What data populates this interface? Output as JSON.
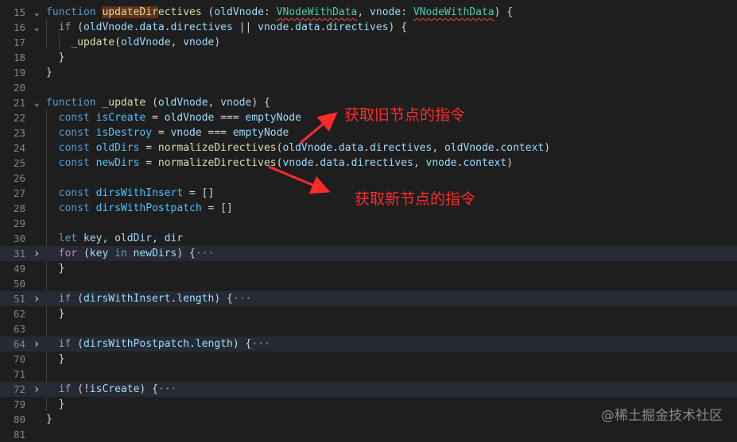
{
  "lines": [
    {
      "num": "15",
      "fold": "open",
      "tokens": [
        [
          "kw",
          "function"
        ],
        [
          "op",
          " "
        ],
        [
          "fn sel",
          "updateDir"
        ],
        [
          "fn",
          "ectives"
        ],
        [
          "op",
          " ("
        ],
        [
          "var",
          "oldVnode"
        ],
        [
          "op",
          ": "
        ],
        [
          "typ squig",
          "VNodeWithData"
        ],
        [
          "op",
          ", "
        ],
        [
          "var",
          "vnode"
        ],
        [
          "op",
          ": "
        ],
        [
          "typ squig",
          "VNodeWithData"
        ],
        [
          "op",
          ") {"
        ]
      ]
    },
    {
      "num": "16",
      "fold": "open",
      "tokens": [
        [
          "op",
          "  "
        ],
        [
          "ctl",
          "if"
        ],
        [
          "op",
          " ("
        ],
        [
          "var",
          "oldVnode"
        ],
        [
          "op",
          "."
        ],
        [
          "var",
          "data"
        ],
        [
          "op",
          "."
        ],
        [
          "var",
          "directives"
        ],
        [
          "op",
          " || "
        ],
        [
          "var",
          "vnode"
        ],
        [
          "op",
          "."
        ],
        [
          "var",
          "data"
        ],
        [
          "op",
          "."
        ],
        [
          "var",
          "directives"
        ],
        [
          "op",
          ") {"
        ]
      ]
    },
    {
      "num": "17",
      "fold": "",
      "tokens": [
        [
          "op",
          "    "
        ],
        [
          "fn",
          "_update"
        ],
        [
          "op",
          "("
        ],
        [
          "var",
          "oldVnode"
        ],
        [
          "op",
          ", "
        ],
        [
          "var",
          "vnode"
        ],
        [
          "op",
          ")"
        ]
      ]
    },
    {
      "num": "18",
      "fold": "",
      "tokens": [
        [
          "op",
          "  }"
        ]
      ]
    },
    {
      "num": "19",
      "fold": "",
      "tokens": [
        [
          "op",
          "}"
        ]
      ]
    },
    {
      "num": "20",
      "fold": "",
      "tokens": []
    },
    {
      "num": "21",
      "fold": "open",
      "tokens": [
        [
          "kw",
          "function"
        ],
        [
          "op",
          " "
        ],
        [
          "fn",
          "_update"
        ],
        [
          "op",
          " ("
        ],
        [
          "var",
          "oldVnode"
        ],
        [
          "op",
          ", "
        ],
        [
          "var",
          "vnode"
        ],
        [
          "op",
          ") {"
        ]
      ]
    },
    {
      "num": "22",
      "fold": "",
      "tokens": [
        [
          "op",
          "  "
        ],
        [
          "kw",
          "const"
        ],
        [
          "op",
          " "
        ],
        [
          "cst",
          "isCreate"
        ],
        [
          "op",
          " = "
        ],
        [
          "var",
          "oldVnode"
        ],
        [
          "op",
          " === "
        ],
        [
          "var",
          "emptyNode"
        ]
      ]
    },
    {
      "num": "23",
      "fold": "",
      "tokens": [
        [
          "op",
          "  "
        ],
        [
          "kw",
          "const"
        ],
        [
          "op",
          " "
        ],
        [
          "cst",
          "isDestroy"
        ],
        [
          "op",
          " = "
        ],
        [
          "var",
          "vnode"
        ],
        [
          "op",
          " === "
        ],
        [
          "var",
          "emptyNode"
        ]
      ]
    },
    {
      "num": "24",
      "fold": "",
      "tokens": [
        [
          "op",
          "  "
        ],
        [
          "kw",
          "const"
        ],
        [
          "op",
          " "
        ],
        [
          "cst",
          "oldDirs"
        ],
        [
          "op",
          " = "
        ],
        [
          "fn",
          "normalizeDirectives"
        ],
        [
          "op",
          "("
        ],
        [
          "var",
          "oldVnode"
        ],
        [
          "op",
          "."
        ],
        [
          "var",
          "data"
        ],
        [
          "op",
          "."
        ],
        [
          "var",
          "directives"
        ],
        [
          "op",
          ", "
        ],
        [
          "var",
          "oldVnode"
        ],
        [
          "op",
          "."
        ],
        [
          "var",
          "context"
        ],
        [
          "op",
          ")"
        ]
      ]
    },
    {
      "num": "25",
      "fold": "",
      "tokens": [
        [
          "op",
          "  "
        ],
        [
          "kw",
          "const"
        ],
        [
          "op",
          " "
        ],
        [
          "cst",
          "newDirs"
        ],
        [
          "op",
          " = "
        ],
        [
          "fn",
          "normalizeDirectives"
        ],
        [
          "op",
          "("
        ],
        [
          "var",
          "vnode"
        ],
        [
          "op",
          "."
        ],
        [
          "var",
          "data"
        ],
        [
          "op",
          "."
        ],
        [
          "var",
          "directives"
        ],
        [
          "op",
          ", "
        ],
        [
          "var",
          "vnode"
        ],
        [
          "op",
          "."
        ],
        [
          "var",
          "context"
        ],
        [
          "op",
          ")"
        ]
      ]
    },
    {
      "num": "26",
      "fold": "",
      "tokens": []
    },
    {
      "num": "27",
      "fold": "",
      "tokens": [
        [
          "op",
          "  "
        ],
        [
          "kw",
          "const"
        ],
        [
          "op",
          " "
        ],
        [
          "cst",
          "dirsWithInsert"
        ],
        [
          "op",
          " = []"
        ]
      ]
    },
    {
      "num": "28",
      "fold": "",
      "tokens": [
        [
          "op",
          "  "
        ],
        [
          "kw",
          "const"
        ],
        [
          "op",
          " "
        ],
        [
          "cst",
          "dirsWithPostpatch"
        ],
        [
          "op",
          " = []"
        ]
      ]
    },
    {
      "num": "29",
      "fold": "",
      "tokens": []
    },
    {
      "num": "30",
      "fold": "",
      "tokens": [
        [
          "op",
          "  "
        ],
        [
          "kw",
          "let"
        ],
        [
          "op",
          " "
        ],
        [
          "var",
          "key"
        ],
        [
          "op",
          ", "
        ],
        [
          "var",
          "oldDir"
        ],
        [
          "op",
          ", "
        ],
        [
          "var",
          "dir"
        ]
      ]
    },
    {
      "num": "31",
      "fold": "closed",
      "hl": true,
      "tokens": [
        [
          "op",
          "  "
        ],
        [
          "ctl",
          "for"
        ],
        [
          "op",
          " ("
        ],
        [
          "var",
          "key"
        ],
        [
          "op",
          " "
        ],
        [
          "kw",
          "in"
        ],
        [
          "op",
          " "
        ],
        [
          "var",
          "newDirs"
        ],
        [
          "op",
          ") {"
        ],
        [
          "ell",
          "···"
        ]
      ]
    },
    {
      "num": "49",
      "fold": "",
      "tokens": [
        [
          "op",
          "  }"
        ]
      ]
    },
    {
      "num": "50",
      "fold": "",
      "tokens": []
    },
    {
      "num": "51",
      "fold": "closed",
      "hl": true,
      "tokens": [
        [
          "op",
          "  "
        ],
        [
          "ctl",
          "if"
        ],
        [
          "op",
          " ("
        ],
        [
          "var",
          "dirsWithInsert"
        ],
        [
          "op",
          "."
        ],
        [
          "var",
          "length"
        ],
        [
          "op",
          ") {"
        ],
        [
          "ell",
          "···"
        ]
      ]
    },
    {
      "num": "62",
      "fold": "",
      "tokens": [
        [
          "op",
          "  }"
        ]
      ]
    },
    {
      "num": "63",
      "fold": "",
      "tokens": []
    },
    {
      "num": "64",
      "fold": "closed",
      "hl": true,
      "tokens": [
        [
          "op",
          "  "
        ],
        [
          "ctl",
          "if"
        ],
        [
          "op",
          " ("
        ],
        [
          "var",
          "dirsWithPostpatch"
        ],
        [
          "op",
          "."
        ],
        [
          "var",
          "length"
        ],
        [
          "op",
          ") {"
        ],
        [
          "ell",
          "···"
        ]
      ]
    },
    {
      "num": "70",
      "fold": "",
      "tokens": [
        [
          "op",
          "  }"
        ]
      ]
    },
    {
      "num": "71",
      "fold": "",
      "tokens": []
    },
    {
      "num": "72",
      "fold": "closed",
      "hl": true,
      "tokens": [
        [
          "op",
          "  "
        ],
        [
          "ctl",
          "if"
        ],
        [
          "op",
          " (!"
        ],
        [
          "var",
          "isCreate"
        ],
        [
          "op",
          ") {"
        ],
        [
          "ell",
          "···"
        ]
      ]
    },
    {
      "num": "79",
      "fold": "",
      "tokens": [
        [
          "op",
          "  }"
        ]
      ]
    },
    {
      "num": "80",
      "fold": "",
      "tokens": [
        [
          "op",
          "}"
        ]
      ]
    },
    {
      "num": "81",
      "fold": "",
      "tokens": []
    }
  ],
  "annotations": {
    "old": "获取旧节点的指令",
    "new": "获取新节点的指令"
  },
  "watermark": "@稀土掘金技术社区",
  "colors": {
    "background": "#1e1e1e",
    "annotation": "#ff2a2a",
    "keyword": "#569cd6",
    "function": "#dcdcaa",
    "variable": "#9cdcfe",
    "type": "#4ec9b0"
  }
}
